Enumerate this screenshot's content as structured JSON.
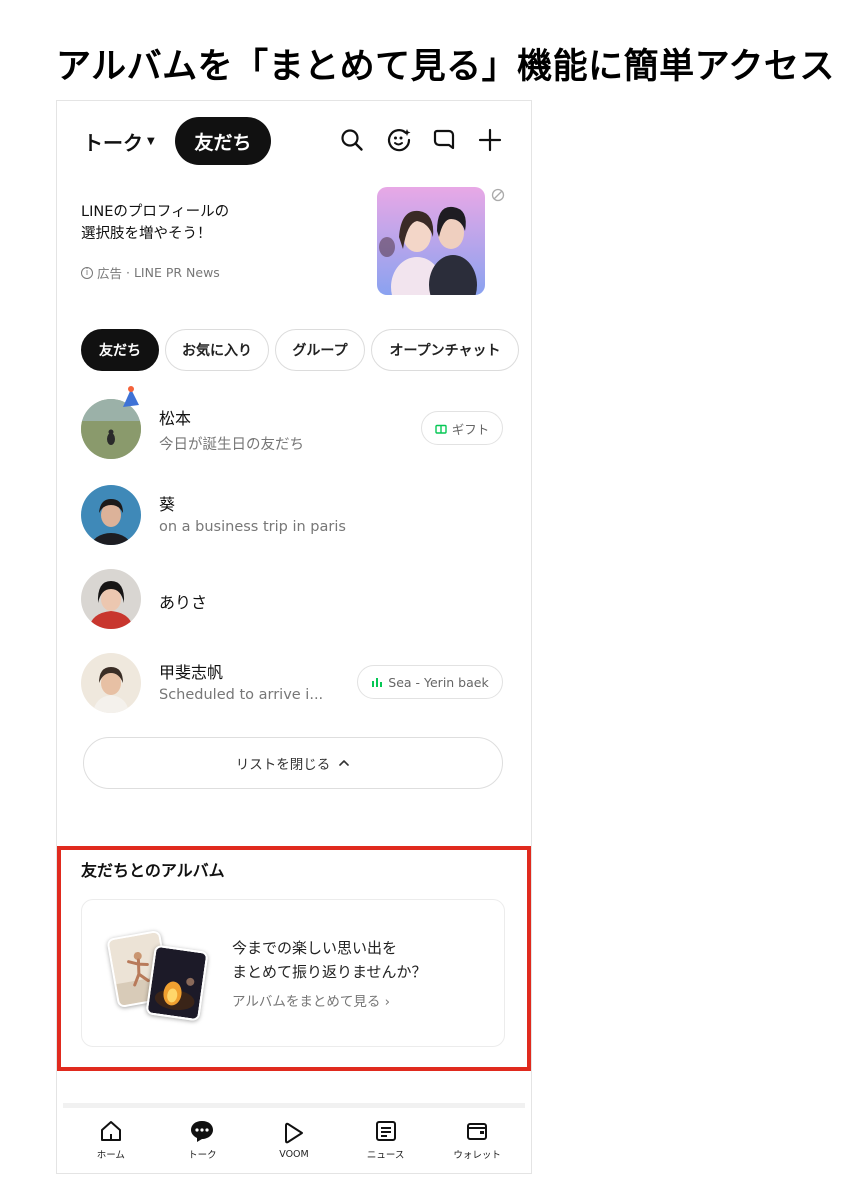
{
  "headline": "アルバムを「まとめて見る」機能に簡単アクセス",
  "header": {
    "title": "トーク",
    "active_pill": "友だち",
    "icons": [
      "search-icon",
      "face-sparkle-icon",
      "chat-bubble-icon",
      "plus-icon"
    ]
  },
  "ad": {
    "line1": "LINEのプロフィールの",
    "line2": "選択肢を増やそう！",
    "label": "広告",
    "source": "· LINE PR News"
  },
  "tabs": [
    {
      "label": "友だち",
      "active": true
    },
    {
      "label": "お気に入り",
      "active": false
    },
    {
      "label": "グループ",
      "active": false
    },
    {
      "label": "オープンチャット",
      "active": false
    }
  ],
  "friends": [
    {
      "name": "松本",
      "status": "今日が誕生日の友だち",
      "chip": "ギフト"
    },
    {
      "name": "葵",
      "status": "on a business trip in paris"
    },
    {
      "name": "ありさ",
      "status": ""
    },
    {
      "name": "甲斐志帆",
      "status": "Scheduled to arrive i...",
      "chip": "Sea - Yerin baek"
    }
  ],
  "collapse_label": "リストを閉じる",
  "album": {
    "heading": "友だちとのアルバム",
    "line1": "今までの楽しい思い出を",
    "line2": "まとめて振り返りませんか？",
    "link": "アルバムをまとめて見る"
  },
  "nav": [
    {
      "label": "ホーム",
      "icon": "home-icon"
    },
    {
      "label": "トーク",
      "icon": "talk-icon"
    },
    {
      "label": "VOOM",
      "icon": "voom-icon"
    },
    {
      "label": "ニュース",
      "icon": "news-icon"
    },
    {
      "label": "ウォレット",
      "icon": "wallet-icon"
    }
  ],
  "colors": {
    "highlight": "#e02a1e",
    "gift_green": "#06c755",
    "music_green": "#06c755"
  }
}
